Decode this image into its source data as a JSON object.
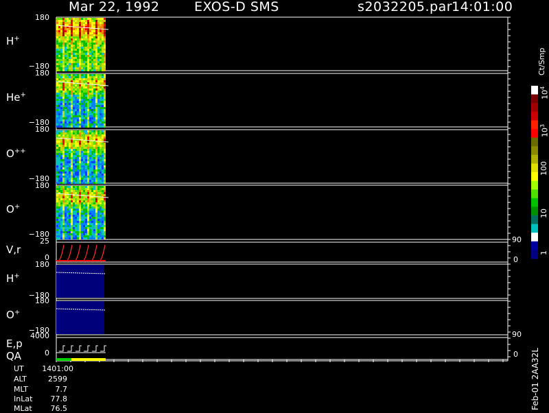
{
  "header": {
    "date": "Mar 22, 1992",
    "instrument": "EXOS-D SMS",
    "file": "s2032205.par",
    "time": "14:01:00"
  },
  "panels": {
    "p1": {
      "label": "H",
      "sup": "+",
      "top_tick": "180",
      "bottom_tick": "−180"
    },
    "p2": {
      "label": "He",
      "sup": "+",
      "top_tick": "180",
      "bottom_tick": "−180"
    },
    "p3": {
      "label": "O",
      "sup": "++",
      "top_tick": "180",
      "bottom_tick": "−180"
    },
    "p4": {
      "label": "O",
      "sup": "+",
      "top_tick": "180",
      "bottom_tick": "−180"
    },
    "p5": {
      "label": "V,r",
      "top_tick": "25",
      "bottom_tick": "0",
      "right_top": "90",
      "right_bottom": "0"
    },
    "p6": {
      "label": "H",
      "sup": "+",
      "top_tick": "180",
      "bottom_tick": "−180"
    },
    "p7": {
      "label": "O",
      "sup": "+",
      "top_tick": "180",
      "bottom_tick": "−180"
    },
    "p8": {
      "label": "E,p",
      "label2": "QA",
      "top_tick": "4000",
      "bottom_tick": "0",
      "right_top": "90",
      "right_bottom": "0"
    }
  },
  "colorbar": {
    "unit": "Ct/Smp",
    "labels": [
      "10",
      "10",
      "100",
      "10",
      "1"
    ],
    "exponents": [
      "4",
      "3",
      "",
      "",
      ""
    ],
    "colors": [
      "#ffffff",
      "#7a0000",
      "#a00000",
      "#cc0000",
      "#ff2000",
      "#ff0000",
      "#6b6b00",
      "#8a8a00",
      "#b0b000",
      "#e0e000",
      "#ffff00",
      "#a0ff00",
      "#50e000",
      "#00c000",
      "#009000",
      "#007060",
      "#00c0c0",
      "#ffffff",
      "#0000a0",
      "#000080"
    ]
  },
  "ephemeris": [
    {
      "label": "UT",
      "value": "1401:00"
    },
    {
      "label": "ALT",
      "value": "2599"
    },
    {
      "label": "MLT",
      "value": "7.7"
    },
    {
      "label": "InLat",
      "value": "77.8"
    },
    {
      "label": "MLat",
      "value": "76.5"
    }
  ],
  "footer_vertical": "Feb-01 2AA32L",
  "chart_data": {
    "type": "heatmap",
    "title": "Mar 22, 1992   EXOS-D SMS",
    "panels": [
      "H+",
      "He+",
      "O++",
      "O+",
      "V,r",
      "H+",
      "O+",
      "E,p QA"
    ],
    "y_range_angle": [
      -180,
      180
    ],
    "colorbar_range_log": [
      1,
      10000
    ],
    "colorbar_unit": "Ct/Smp",
    "data_present_fraction_of_time_axis": 0.09
  }
}
